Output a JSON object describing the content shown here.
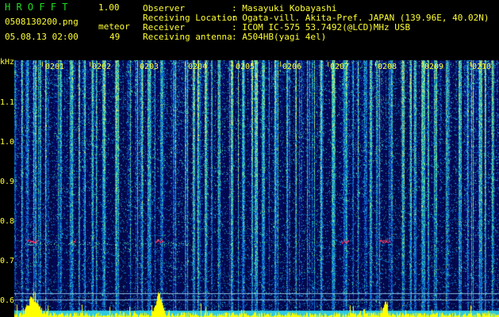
{
  "header": {
    "app_title": "H R O F F T",
    "version": "1.00",
    "filename": "0508130200.png",
    "datetime": "05.08.13 02:00",
    "meteor_label": "meteor",
    "meteor_count": "49",
    "observer_label": "Observer",
    "observer_value": ": Masayuki Kobayashi",
    "location_label": "Receiving Location",
    "location_value": ": Ogata-vill. Akita-Pref. JAPAN (139.96E, 40.02N)",
    "receiver_label": "Receiver",
    "receiver_value": ": ICOM IC-575 53.7492(@LCD)MHz USB",
    "antenna_label": "Receiving antenna",
    "antenna_value": ": A504HB(yagi 4el)"
  },
  "spectrogram": {
    "yaxis_unit": "kHz",
    "yticks": [
      "1.1",
      "1.0",
      "0.9",
      "0.8",
      "0.7",
      "0.6"
    ],
    "time_labels": [
      "0201",
      "0202",
      "0203",
      "0204",
      "0205",
      "0206",
      "0207",
      "0208",
      "0209",
      "0210"
    ]
  },
  "colors": {
    "background": "#000000",
    "header_text": "#ffff33",
    "title_text": "#22dd22",
    "noise_low": "#0a1060",
    "noise_mid": "#1e50c8",
    "noise_high": "#30c8a0",
    "meteor_echo": "#ff3060",
    "activity_bars": "#ffff00",
    "baseline": "#30c8e0"
  }
}
